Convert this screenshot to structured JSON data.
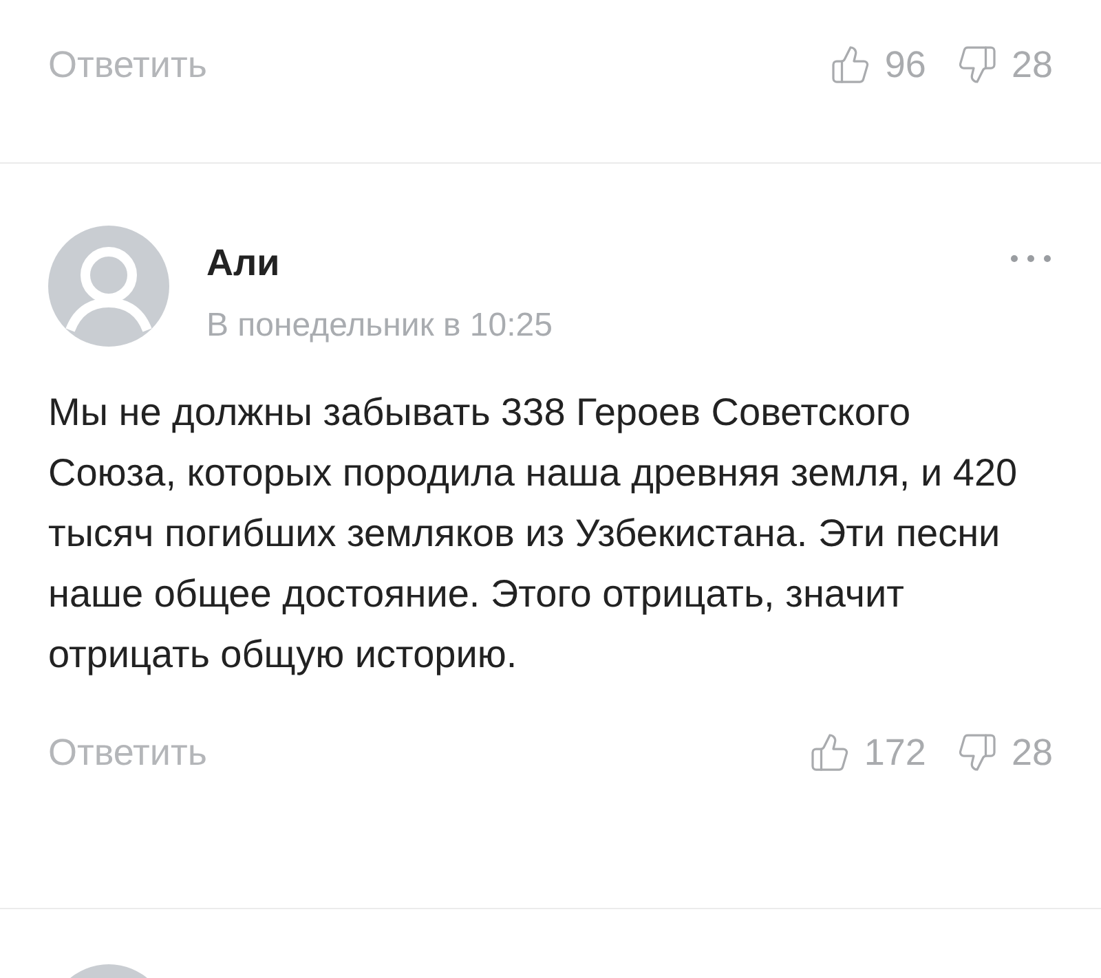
{
  "previous_comment_actions": {
    "reply": "Ответить",
    "likes": "96",
    "dislikes": "28"
  },
  "comment": {
    "author": "Али",
    "time": "В понедельник в 10:25",
    "text": "Мы не должны забывать 338 Героев Советского Союза, которых породила наша древняя земля, и 420 тысяч погибших земляков из Узбекистана. Эти песни наше общее достояние. Этого отрицать, значит отрицать общую историю.",
    "reply": "Ответить",
    "likes": "172",
    "dislikes": "28"
  }
}
